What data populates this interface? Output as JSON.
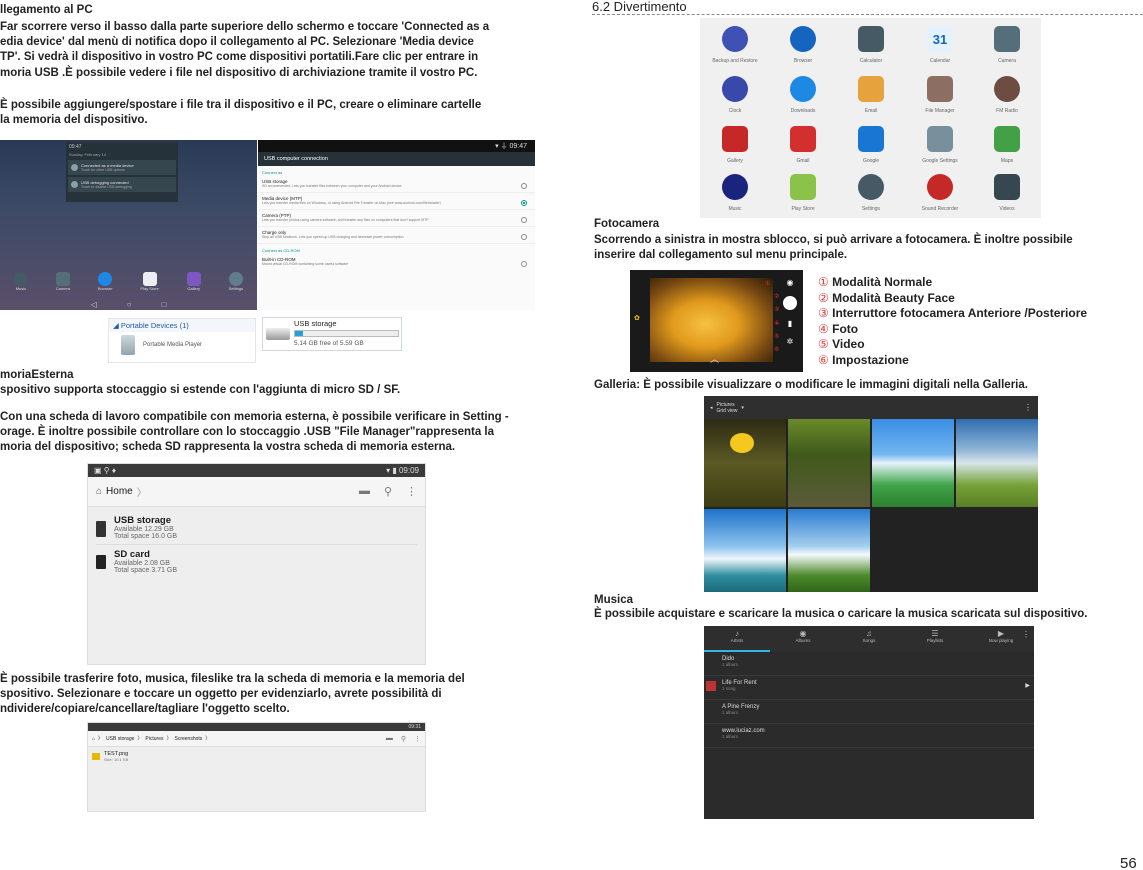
{
  "left": {
    "pc_heading": "llegamento al PC",
    "pc_para": [
      "Far scorrere verso il basso dalla parte superiore dello schermo e toccare 'Connected as a",
      "edia device' dal menù di notifica dopo il collegamento al PC. Selezionare 'Media device",
      "TP'. Si vedrà il dispositivo in vostro PC come dispositivi portatili.Fare clic per entrare in",
      "moria USB .È possibile vedere i file nel dispositivo di archiviazione tramite il vostro PC."
    ],
    "pc_para2": [
      "È possibile aggiungere/spostare i file tra il dispositivo e il PC, creare o eliminare cartelle",
      "la memoria del dispositivo."
    ],
    "notif": {
      "time": "09:47",
      "date": "Sunday, February 14",
      "items": [
        {
          "title": "Connected as a media device",
          "sub": "Touch for other USB options"
        },
        {
          "title": "USB debugging connected",
          "sub": "Touch to disable USB debugging"
        }
      ],
      "dock": [
        "Music",
        "Camera",
        "Browser",
        "Play Store",
        "Gallery",
        "Settings"
      ]
    },
    "usb_conn": {
      "title": "USB computer connection",
      "section1": "Connect as",
      "options": [
        {
          "name": "USB storage",
          "desc": "SD recommended. Lets you transfer files between your computer and your Android device.",
          "selected": false
        },
        {
          "name": "Media device (MTP)",
          "desc": "Lets you transfer media files on Windows, or using Android File Transfer on Mac (see www.android.com/filetransfer)",
          "selected": true
        },
        {
          "name": "Camera (PTP)",
          "desc": "Lets you transfer photos using camera software, and transfer any files on computers that don't support MTP",
          "selected": false
        },
        {
          "name": "Charge only",
          "desc": "Stop all USB functions. Lets you speed up USB charging and decrease power consumption.",
          "selected": false
        }
      ],
      "section2": "Connect as CD-ROM",
      "cdrom": {
        "name": "Built-in CD-ROM",
        "desc": "Mount virtual CD-ROM containing some useful software",
        "selected": false
      }
    },
    "portable": {
      "header": "Portable Devices (1)",
      "device": "Portable Media Player"
    },
    "usbbox": {
      "title": "USB storage",
      "free": "5.14 GB free of 5.59 GB",
      "fill_fraction": 0.08
    },
    "ext_heading": "moriaEsterna",
    "ext_line": "spositivo supporta stoccaggio si estende con l'aggiunta di micro SD / SF.",
    "ext_para": [
      "Con una scheda di lavoro compatibile con memoria esterna, è possibile verificare in Setting -",
      "orage. È inoltre possibile controllare con lo stoccaggio .USB \"File Manager\"rappresenta la",
      "moria del dispositivo; scheda SD rappresenta la vostra scheda di memoria esterna."
    ],
    "fm": {
      "time": "09:09",
      "home": "Home",
      "items": [
        {
          "name": "USB storage",
          "l1": "Available 12.29 GB",
          "l2": "Total space 16.0 GB"
        },
        {
          "name": "SD card",
          "l1": "Available 2.08 GB",
          "l2": "Total space 3.71 GB"
        }
      ]
    },
    "transfer_para": [
      "È possibile trasferire foto, musica, fileslike tra la scheda di memoria e la memoria del",
      "spositivo. Selezionare e toccare un oggetto per evidenziarlo, avrete possibilità di",
      "ndividere/copiare/cancellare/tagliare l'oggetto scelto."
    ],
    "fm2": {
      "time": "09:31",
      "crumbs": [
        "USB storage",
        "Pictures",
        "Screenshots"
      ],
      "file": "TEST.png",
      "size": "Size: 10.1 KB"
    }
  },
  "right": {
    "section_title": "6.2 Divertimento",
    "apps": [
      "Backup and Restore",
      "Browser",
      "Calculator",
      "Calendar",
      "Camera",
      "Clock",
      "Downloads",
      "Email",
      "File Manager",
      "FM Radio",
      "Gallery",
      "Gmail",
      "Google",
      "Google Settings",
      "Maps",
      "Music",
      "Play Store",
      "Settings",
      "Sound Recorder",
      "Videos"
    ],
    "calendar_day": "31",
    "camera_heading": "Fotocamera",
    "camera_para": [
      "Scorrendo a sinistra in mostra sblocco, si può arrivare a fotocamera. È inoltre possibile",
      "inserire dal collegamento sul menu principale."
    ],
    "camera_list": [
      {
        "n": "①",
        "t": "Modalità Normale"
      },
      {
        "n": "②",
        "t": "Modalità Beauty Face"
      },
      {
        "n": "③",
        "t": "Interruttore fotocamera Anteriore /Posteriore"
      },
      {
        "n": "④",
        "t": "Foto"
      },
      {
        "n": "⑤",
        "t": "Video"
      },
      {
        "n": "⑥",
        "t": "Impostazione"
      }
    ],
    "cam_marks": [
      "①",
      "②",
      "③",
      "④",
      "⑤",
      "⑥"
    ],
    "gallery_line": "Galleria: È possibile visualizzare o modificare le immagini digitali nella Galleria.",
    "gallery_bar": {
      "title": "Pictures",
      "sub": "Grid view"
    },
    "music_heading": "Musica",
    "music_line": "È possibile acquistare e scaricare la musica o caricare la musica scaricata sul dispositivo.",
    "music": {
      "tabs": [
        "Artists",
        "Albums",
        "Songs",
        "Playlists",
        "Now playing"
      ],
      "items": [
        {
          "name": "Dido",
          "sub": "1 album"
        },
        {
          "name": "Life For Rent",
          "sub": "1 song"
        },
        {
          "name": "A Pine Frenzy",
          "sub": "1 album"
        },
        {
          "name": "www.luciaz.com",
          "sub": "1 album"
        }
      ]
    },
    "page_number": "56"
  }
}
